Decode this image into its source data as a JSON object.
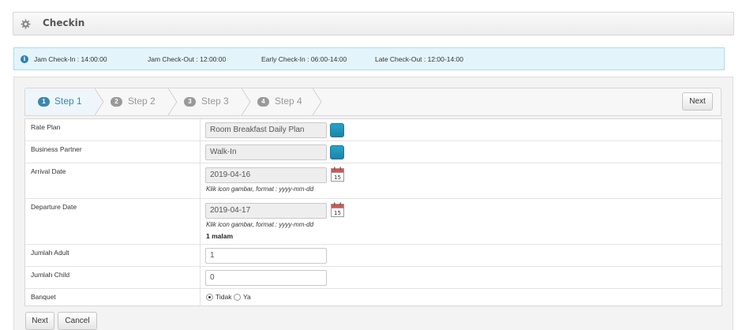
{
  "page": {
    "title": "Checkin",
    "title_icon": "gear-icon"
  },
  "info": {
    "icon": "info-icon",
    "checkin": "Jam Check-In : 14:00:00",
    "checkout": "Jam Check-Out : 12:00:00",
    "early": "Early Check-In : 06:00-14:00",
    "late": "Late Check-Out : 12:00-14:00"
  },
  "wizard": {
    "steps": [
      {
        "num": "1",
        "label": "Step 1",
        "active": true
      },
      {
        "num": "2",
        "label": "Step 2",
        "active": false
      },
      {
        "num": "3",
        "label": "Step 3",
        "active": false
      },
      {
        "num": "4",
        "label": "Step 4",
        "active": false
      }
    ],
    "next_label": "Next"
  },
  "form": {
    "rate_plan": {
      "label": "Rate Plan",
      "value": "Room Breakfast Daily Plan"
    },
    "business_partner": {
      "label": "Business Partner",
      "value": "Walk-In"
    },
    "arrival": {
      "label": "Arrival Date",
      "value": "2019-04-16",
      "hint": "Klik icon gambar, format : yyyy-mm-dd"
    },
    "departure": {
      "label": "Departure Date",
      "value": "2019-04-17",
      "hint": "Klik icon gambar, format : yyyy-mm-dd",
      "nights": "1 malam"
    },
    "adult": {
      "label": "Jumlah Adult",
      "value": "1"
    },
    "child": {
      "label": "Jumlah Child",
      "value": "0"
    },
    "banquet": {
      "label": "Banquet",
      "options": [
        "Tidak",
        "Ya"
      ],
      "selected": "Tidak"
    },
    "calendar_day": "15"
  },
  "footer": {
    "next_label": "Next",
    "cancel_label": "Cancel"
  },
  "colors": {
    "accent": "#3a87ad",
    "lookup": "#1f8fb6",
    "info_bg": "#e4f4fb",
    "info_border": "#a9dcef"
  }
}
